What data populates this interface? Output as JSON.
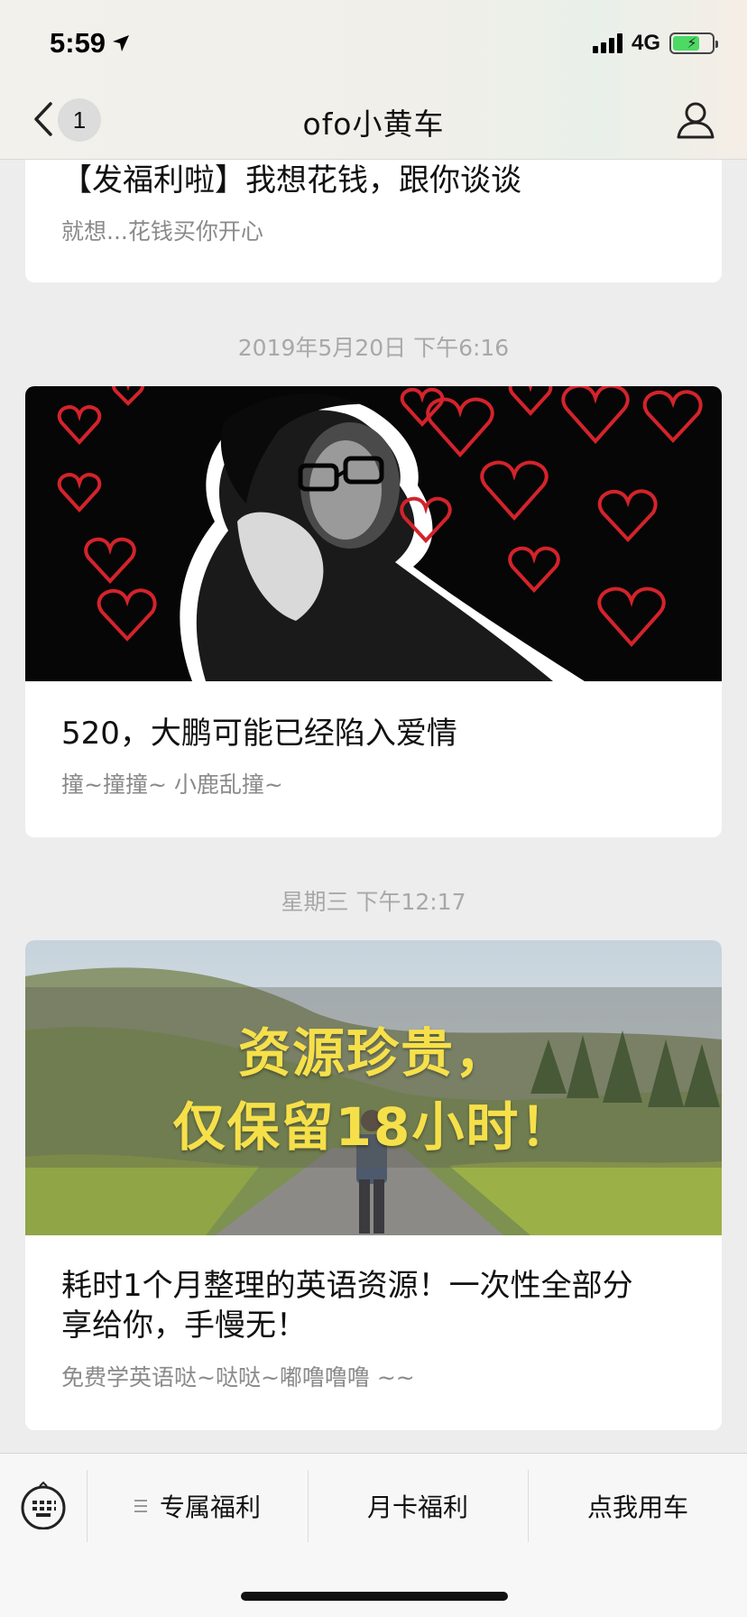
{
  "status_bar": {
    "time": "5:59",
    "network": "4G",
    "battery_color": "#4cd964"
  },
  "nav": {
    "back_icon": "chevron-left-icon",
    "unread_count": "1",
    "title": "ofo小黄车",
    "profile_icon": "person-icon"
  },
  "feed": {
    "articles": [
      {
        "title": "【发福利啦】我想花钱，跟你谈谈",
        "desc": "就想...花钱买你开心"
      },
      {
        "timestamp": "2019年5月20日 下午6:16",
        "title": "520，大鹏可能已经陷入爱情",
        "desc": "撞~撞撞~ 小鹿乱撞~"
      },
      {
        "timestamp": "星期三 下午12:17",
        "overlay_line1": "资源珍贵，",
        "overlay_line2": "仅保留18小时！",
        "title_line1": "耗时1个月整理的英语资源！一次性全部分",
        "title_line2": "享给你，手慢无！",
        "desc": "免费学英语哒~哒哒~嘟噜噜噜 ~~"
      }
    ]
  },
  "bottom_menu": {
    "keyboard_icon": "keyboard-icon",
    "items": [
      {
        "label": "专属福利",
        "icon": "menu-lines-icon"
      },
      {
        "label": "月卡福利"
      },
      {
        "label": "点我用车"
      }
    ]
  },
  "colors": {
    "background": "#ededed",
    "card": "#ffffff",
    "accent_yellow": "#f6e04a",
    "heart_red": "#d4232b"
  }
}
